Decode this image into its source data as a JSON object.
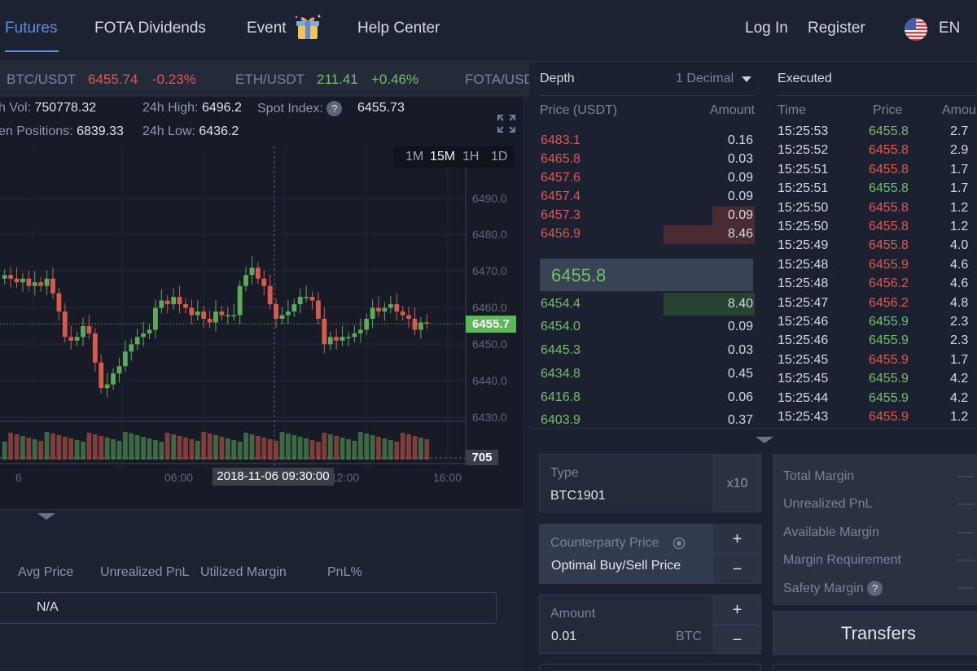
{
  "nav": {
    "items": [
      "Futures",
      "FOTA Dividends",
      "Event",
      "Help Center"
    ],
    "login": "Log In",
    "register": "Register",
    "language": "EN"
  },
  "ticker": [
    {
      "pair": "BTC/USDT",
      "price": "6455.74",
      "change": "-0.23%",
      "trend": "down"
    },
    {
      "pair": "ETH/USDT",
      "price": "211.41",
      "change": "+0.46%",
      "trend": "up"
    },
    {
      "pair": "FOTA/USDT",
      "price": "",
      "change": "",
      "trend": ""
    }
  ],
  "stats": {
    "vol_label": "h Vol:",
    "vol": "750778.32",
    "high_label": "24h High:",
    "high": "6496.2",
    "spot_label": "Spot Index:",
    "spot": "6455.73",
    "pos_label": "en Positions:",
    "pos": "6839.33",
    "low_label": "24h Low:",
    "low": "6436.2"
  },
  "timeframes": [
    "1M",
    "15M",
    "1H",
    "1D"
  ],
  "chart": {
    "y_ticks": [
      "6490.0",
      "6480.0",
      "6470.0",
      "6460.0",
      "6450.0",
      "6440.0",
      "6430.0"
    ],
    "x_ticks": [
      "6",
      "06:00",
      "12:00",
      "16:00"
    ],
    "last_price": "6455.7",
    "last_volume": "705",
    "crosshair_time": "2018-11-06 09:30:00",
    "up_color": "#5daa57",
    "down_color": "#d9594b"
  },
  "positions": {
    "columns": [
      "Avg Price",
      "Unrealized PnL",
      "Utilized Margin",
      "PnL%"
    ],
    "empty_text": "N/A"
  },
  "depth": {
    "title": "Depth",
    "decimal": "1 Decimal",
    "col_price": "Price (USDT)",
    "col_amount": "Amount",
    "asks": [
      {
        "price": "6483.1",
        "amount": "0.16"
      },
      {
        "price": "6465.8",
        "amount": "0.03"
      },
      {
        "price": "6457.6",
        "amount": "0.09"
      },
      {
        "price": "6457.4",
        "amount": "0.09"
      },
      {
        "price": "6457.3",
        "amount": "0.09"
      },
      {
        "price": "6456.9",
        "amount": "8.46"
      }
    ],
    "last_price": "6455.8",
    "bids": [
      {
        "price": "6454.4",
        "amount": "8.40"
      },
      {
        "price": "6454.0",
        "amount": "0.09"
      },
      {
        "price": "6445.3",
        "amount": "0.03"
      },
      {
        "price": "6434.8",
        "amount": "0.45"
      },
      {
        "price": "6416.8",
        "amount": "0.06"
      },
      {
        "price": "6403.9",
        "amount": "0.37"
      }
    ]
  },
  "executed": {
    "title": "Executed",
    "col_time": "Time",
    "col_price": "Price",
    "col_amount": "Amou",
    "trades": [
      {
        "time": "15:25:53",
        "price": "6455.8",
        "amount": "2.7",
        "side": "up"
      },
      {
        "time": "15:25:52",
        "price": "6455.8",
        "amount": "2.9",
        "side": "down"
      },
      {
        "time": "15:25:51",
        "price": "6455.8",
        "amount": "1.7",
        "side": "down"
      },
      {
        "time": "15:25:51",
        "price": "6455.8",
        "amount": "1.7",
        "side": "up"
      },
      {
        "time": "15:25:50",
        "price": "6455.8",
        "amount": "1.2",
        "side": "down"
      },
      {
        "time": "15:25:50",
        "price": "6455.8",
        "amount": "1.2",
        "side": "down"
      },
      {
        "time": "15:25:49",
        "price": "6455.8",
        "amount": "4.0",
        "side": "down"
      },
      {
        "time": "15:25:48",
        "price": "6455.9",
        "amount": "4.6",
        "side": "down"
      },
      {
        "time": "15:25:48",
        "price": "6456.2",
        "amount": "4.6",
        "side": "down"
      },
      {
        "time": "15:25:47",
        "price": "6456.2",
        "amount": "4.8",
        "side": "down"
      },
      {
        "time": "15:25:46",
        "price": "6455.9",
        "amount": "2.3",
        "side": "up"
      },
      {
        "time": "15:25:46",
        "price": "6455.9",
        "amount": "2.3",
        "side": "up"
      },
      {
        "time": "15:25:45",
        "price": "6455.9",
        "amount": "1.7",
        "side": "down"
      },
      {
        "time": "15:25:45",
        "price": "6455.9",
        "amount": "4.2",
        "side": "up"
      },
      {
        "time": "15:25:44",
        "price": "6455.9",
        "amount": "4.2",
        "side": "up"
      },
      {
        "time": "15:25:43",
        "price": "6455.9",
        "amount": "1.2",
        "side": "down"
      }
    ]
  },
  "order": {
    "type_label": "Type",
    "type_value": "BTC1901",
    "leverage": "x10",
    "counterparty_label": "Counterparty Price",
    "counterparty_value": "Optimal Buy/Sell Price",
    "amount_label": "Amount",
    "amount_value": "0.01",
    "amount_unit": "BTC",
    "plus": "+",
    "minus": "−"
  },
  "margin": {
    "rows": [
      {
        "label": "Total Margin",
        "value": "----"
      },
      {
        "label": "Unrealized PnL",
        "value": "----"
      },
      {
        "label": "Available Margin",
        "value": "----"
      },
      {
        "label": "Margin Requirement",
        "value": "----"
      },
      {
        "label": "Safety Margin",
        "value": "----"
      }
    ],
    "transfers": "Transfers"
  }
}
